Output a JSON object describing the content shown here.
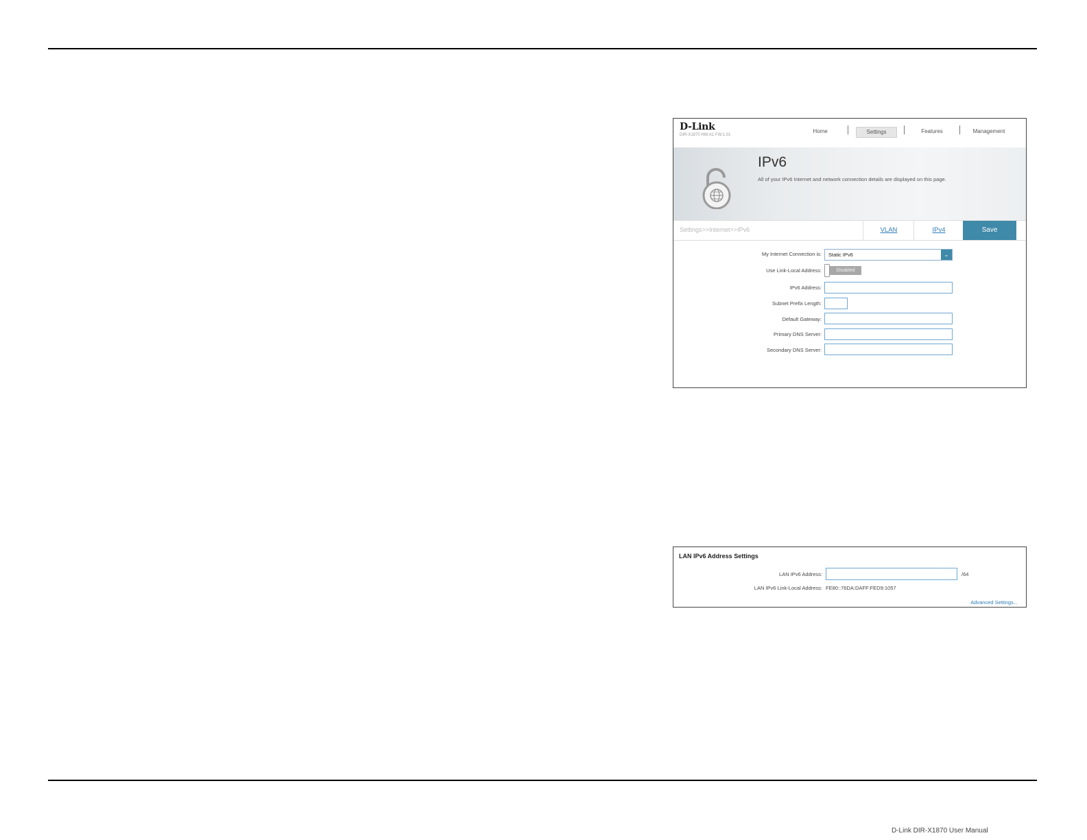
{
  "ipv6_screen": {
    "brand": "D-Link",
    "model": "DIR-X1870 HW:A1 FW:1.01",
    "nav": [
      "Home",
      "Settings",
      "Features",
      "Management"
    ],
    "active_nav": "Settings",
    "page_title": "IPv6",
    "page_description": "All of your IPv6 Internet and network connection details are displayed on this page.",
    "breadcrumb": "Settings>>Internet>>IPv6",
    "tabs": [
      "VLAN",
      "IPv4"
    ],
    "save_label": "Save",
    "form": {
      "connection_label": "My Internet Connection is:",
      "connection_value": "Static IPv6",
      "link_local_label": "Use Link-Local Address:",
      "link_local_value": "Disabled",
      "ipv6_address_label": "IPv6 Address:",
      "ipv6_address_value": "",
      "prefix_length_label": "Subnet Prefix Length:",
      "prefix_length_value": "",
      "gateway_label": "Default Gateway:",
      "gateway_value": "",
      "primary_dns_label": "Primary DNS Server:",
      "primary_dns_value": "",
      "secondary_dns_label": "Secondary DNS Server:",
      "secondary_dns_value": ""
    }
  },
  "lan_screen": {
    "title": "LAN IPv6 Address Settings",
    "lan_address_label": "LAN IPv6 Address:",
    "lan_address_value": "",
    "lan_address_suffix": "/64",
    "link_local_label": "LAN IPv6 Link-Local Address:",
    "link_local_value": "FE80::76DA:DAFF:FED9:1057",
    "advanced_link": "Advanced Settings..."
  },
  "footer": {
    "text": "D-Link DIR-X1870 User Manual"
  },
  "colors": {
    "accent": "#3f89a9",
    "link": "#2e7bb8",
    "input_border": "#6ea7d3"
  }
}
